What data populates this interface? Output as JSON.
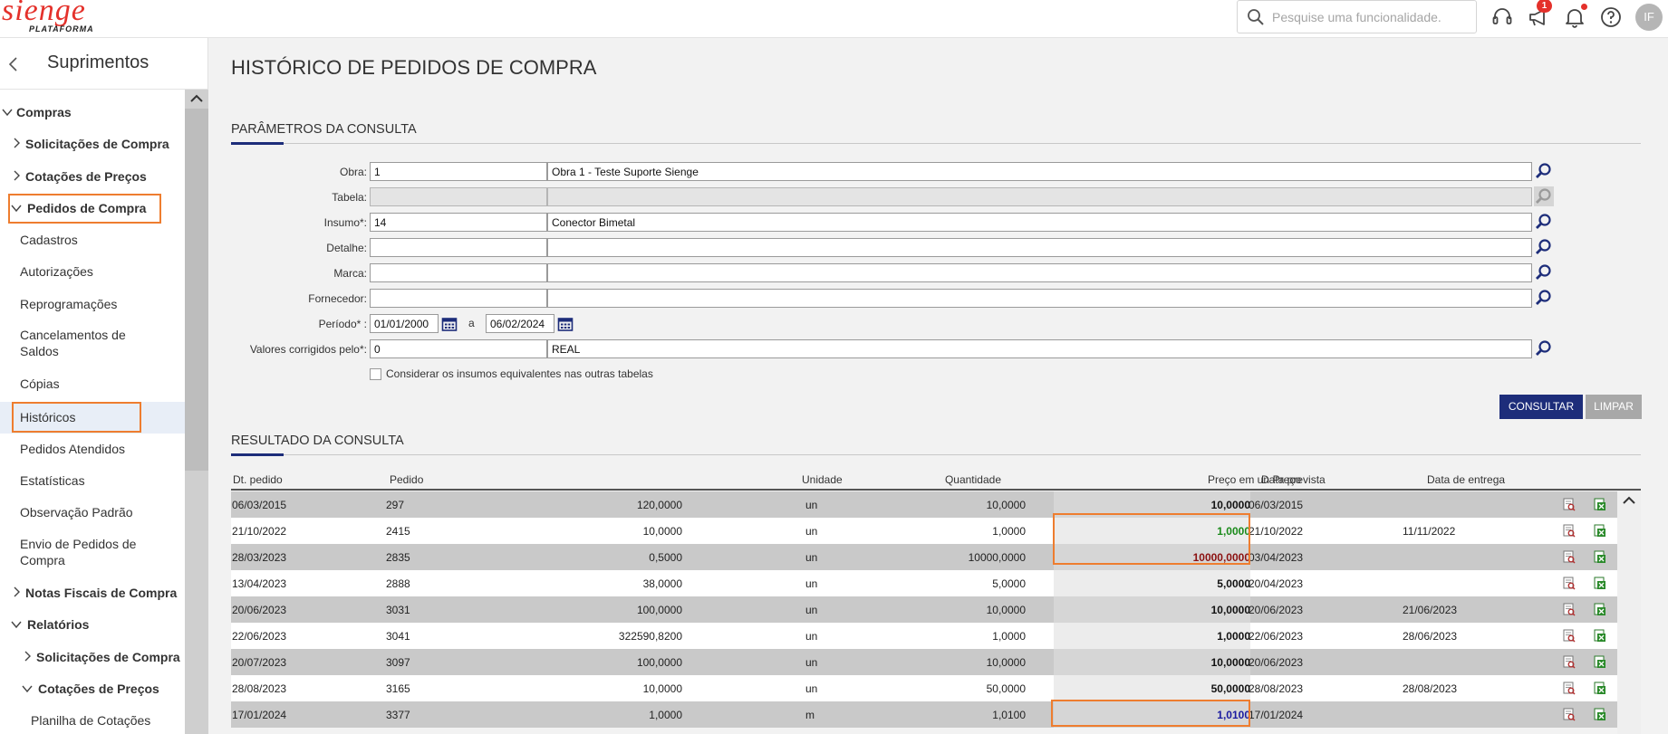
{
  "brand": {
    "name": "sienge",
    "sub": "PLATAFORMA",
    "color": "#e4312b"
  },
  "topbar": {
    "search_placeholder": "Pesquise uma funcionalidade.",
    "notification_count": "1",
    "user_initials": "IF"
  },
  "sidebar": {
    "title": "Suprimentos",
    "items": [
      {
        "label": "Compras"
      },
      {
        "label": "Solicitações de Compra"
      },
      {
        "label": "Cotações de Preços"
      },
      {
        "label": "Pedidos de Compra"
      },
      {
        "label": "Cadastros"
      },
      {
        "label": "Autorizações"
      },
      {
        "label": "Reprogramações"
      },
      {
        "label": "Cancelamentos de Saldos"
      },
      {
        "label": "Cópias"
      },
      {
        "label": "Históricos"
      },
      {
        "label": "Pedidos Atendidos"
      },
      {
        "label": "Estatísticas"
      },
      {
        "label": "Observação Padrão"
      },
      {
        "label": "Envio de Pedidos de Compra"
      },
      {
        "label": "Notas Fiscais de Compra"
      },
      {
        "label": "Relatórios"
      },
      {
        "label": "Solicitações de Compra"
      },
      {
        "label": "Cotações de Preços"
      },
      {
        "label": "Planilha de Cotações"
      }
    ]
  },
  "page": {
    "title": "HISTÓRICO DE PEDIDOS DE COMPRA"
  },
  "params": {
    "section_title": "PARÂMETROS DA CONSULTA",
    "obra": {
      "label": "Obra:",
      "code": "1",
      "desc": "Obra 1 - Teste Suporte Sienge"
    },
    "tabela": {
      "label": "Tabela:",
      "code": "",
      "desc": ""
    },
    "insumo": {
      "label": "Insumo*:",
      "code": "14",
      "desc": "Conector Bimetal"
    },
    "detalhe": {
      "label": "Detalhe:",
      "code": "",
      "desc": ""
    },
    "marca": {
      "label": "Marca:",
      "code": "",
      "desc": ""
    },
    "fornecedor": {
      "label": "Fornecedor:",
      "code": "",
      "desc": ""
    },
    "periodo": {
      "label": "Período* :",
      "from": "01/01/2000",
      "sep": "a",
      "to": "06/02/2024"
    },
    "valores": {
      "label": "Valores corrigidos pelo*:",
      "code": "0",
      "desc": "REAL"
    },
    "checkbox_label": "Considerar os insumos equivalentes nas outras tabelas",
    "consultar": "CONSULTAR",
    "limpar": "LIMPAR"
  },
  "results": {
    "section_title": "RESULTADO DA CONSULTA",
    "columns": {
      "dt_pedido": "Dt. pedido",
      "pedido": "Pedido",
      "quantidade": "Quantidade",
      "unidade": "Unidade",
      "preco": "Preço",
      "preco_em": "Preço em un",
      "data_prevista": "Data prevista",
      "data_entrega": "Data de entrega"
    },
    "rows": [
      {
        "dt": "06/03/2015",
        "pedido": "297",
        "qtd": "120,0000",
        "un": "un",
        "preco": "10,0000",
        "preco_em": "10,0000",
        "color": "#111111",
        "prev": "06/03/2015",
        "entrega": ""
      },
      {
        "dt": "21/10/2022",
        "pedido": "2415",
        "qtd": "10,0000",
        "un": "un",
        "preco": "1,0000",
        "preco_em": "1,0000",
        "color": "#1a8a1a",
        "prev": "21/10/2022",
        "entrega": "11/11/2022"
      },
      {
        "dt": "28/03/2023",
        "pedido": "2835",
        "qtd": "0,5000",
        "un": "un",
        "preco": "10000,0000",
        "preco_em": "10000,0000",
        "color": "#8b1010",
        "prev": "03/04/2023",
        "entrega": ""
      },
      {
        "dt": "13/04/2023",
        "pedido": "2888",
        "qtd": "38,0000",
        "un": "un",
        "preco": "5,0000",
        "preco_em": "5,0000",
        "color": "#111111",
        "prev": "20/04/2023",
        "entrega": ""
      },
      {
        "dt": "20/06/2023",
        "pedido": "3031",
        "qtd": "100,0000",
        "un": "un",
        "preco": "10,0000",
        "preco_em": "10,0000",
        "color": "#111111",
        "prev": "20/06/2023",
        "entrega": "21/06/2023"
      },
      {
        "dt": "22/06/2023",
        "pedido": "3041",
        "qtd": "322590,8200",
        "un": "un",
        "preco": "1,0000",
        "preco_em": "1,0000",
        "color": "#111111",
        "prev": "22/06/2023",
        "entrega": "28/06/2023"
      },
      {
        "dt": "20/07/2023",
        "pedido": "3097",
        "qtd": "100,0000",
        "un": "un",
        "preco": "10,0000",
        "preco_em": "10,0000",
        "color": "#111111",
        "prev": "20/06/2023",
        "entrega": ""
      },
      {
        "dt": "28/08/2023",
        "pedido": "3165",
        "qtd": "10,0000",
        "un": "un",
        "preco": "50,0000",
        "preco_em": "50,0000",
        "color": "#111111",
        "prev": "28/08/2023",
        "entrega": "28/08/2023"
      },
      {
        "dt": "17/01/2024",
        "pedido": "3377",
        "qtd": "1,0000",
        "un": "m",
        "preco": "1,0100",
        "preco_em": "1,0100",
        "color": "#1a1aa0",
        "prev": "17/01/2024",
        "entrega": ""
      }
    ]
  },
  "colors": {
    "accent": "#1d2d7a",
    "highlight": "#ee7d2f",
    "row_grey": "#c9c9c9"
  }
}
